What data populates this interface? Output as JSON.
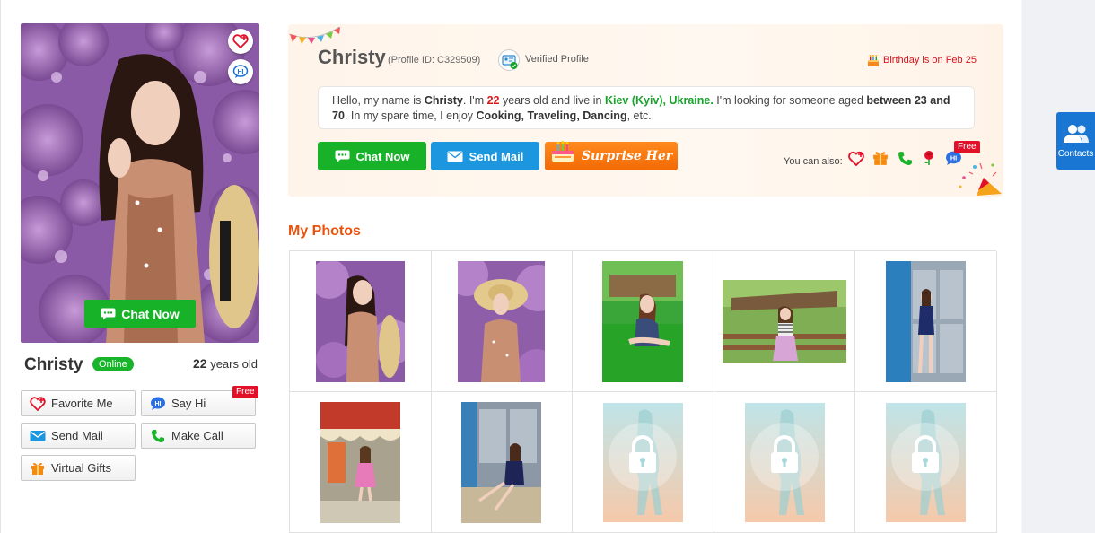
{
  "profile": {
    "name": "Christy",
    "profile_id_text": "(Profile ID: C329509)",
    "verified_text": "Verified Profile",
    "birthday_text": "Birthday is on Feb 25",
    "online_label": "Online",
    "age_number": "22",
    "age_suffix": " years old"
  },
  "bio": {
    "p1": "Hello, my name is ",
    "name": "Christy",
    "p2": ". I'm ",
    "age": "22",
    "p3": " years old and live in ",
    "city": "Kiev (Kyiv), Ukraine.",
    "p4": " I'm looking for someone aged ",
    "range": "between 23 and 70",
    "p5": ". In my spare time, I enjoy ",
    "hobbies": "Cooking, Traveling, Dancing",
    "p6": ", etc."
  },
  "buttons": {
    "photo_chat": "Chat Now",
    "chat_now": "Chat Now",
    "send_mail": "Send Mail",
    "surprise_her": "Surprise Her",
    "you_can_also": "You can also:",
    "free": "Free"
  },
  "left_actions": {
    "favorite": "Favorite Me",
    "say_hi": "Say Hi",
    "send_mail": "Send Mail",
    "make_call": "Make Call",
    "virtual_gifts": "Virtual Gifts",
    "free": "Free"
  },
  "photos": {
    "title": "My Photos"
  },
  "sidebar": {
    "contacts_label": "Contacts"
  },
  "colors": {
    "accent_green": "#17b227",
    "accent_blue": "#1c96de",
    "accent_orange": "#f26a06",
    "title_orange": "#e8520f"
  },
  "icons": [
    "heart-plus-icon",
    "hi-bubble-icon",
    "chat-icon",
    "mail-icon",
    "phone-icon",
    "gift-icon",
    "rose-icon",
    "cake-icon",
    "verified-id-icon",
    "lock-icon",
    "contacts-icon"
  ]
}
